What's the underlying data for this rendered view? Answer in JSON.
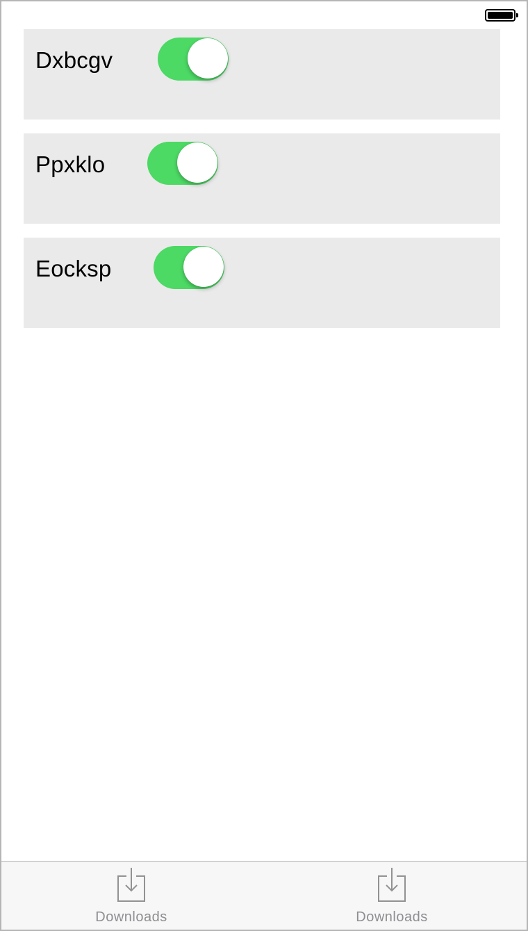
{
  "status_bar": {
    "battery_icon": "battery-full-icon"
  },
  "items": [
    {
      "label": "Dxbcgv",
      "toggle_on": true
    },
    {
      "label": "Ppxklo",
      "toggle_on": true
    },
    {
      "label": "Eocksp",
      "toggle_on": true
    }
  ],
  "tab_bar": {
    "tabs": [
      {
        "label": "Downloads",
        "icon": "download-icon"
      },
      {
        "label": "Downloads",
        "icon": "download-icon"
      }
    ]
  },
  "colors": {
    "toggle_on": "#4cd964",
    "card_background": "#eaeaea",
    "tab_bar_background": "#f7f7f7",
    "tab_label": "#8e8e93"
  }
}
